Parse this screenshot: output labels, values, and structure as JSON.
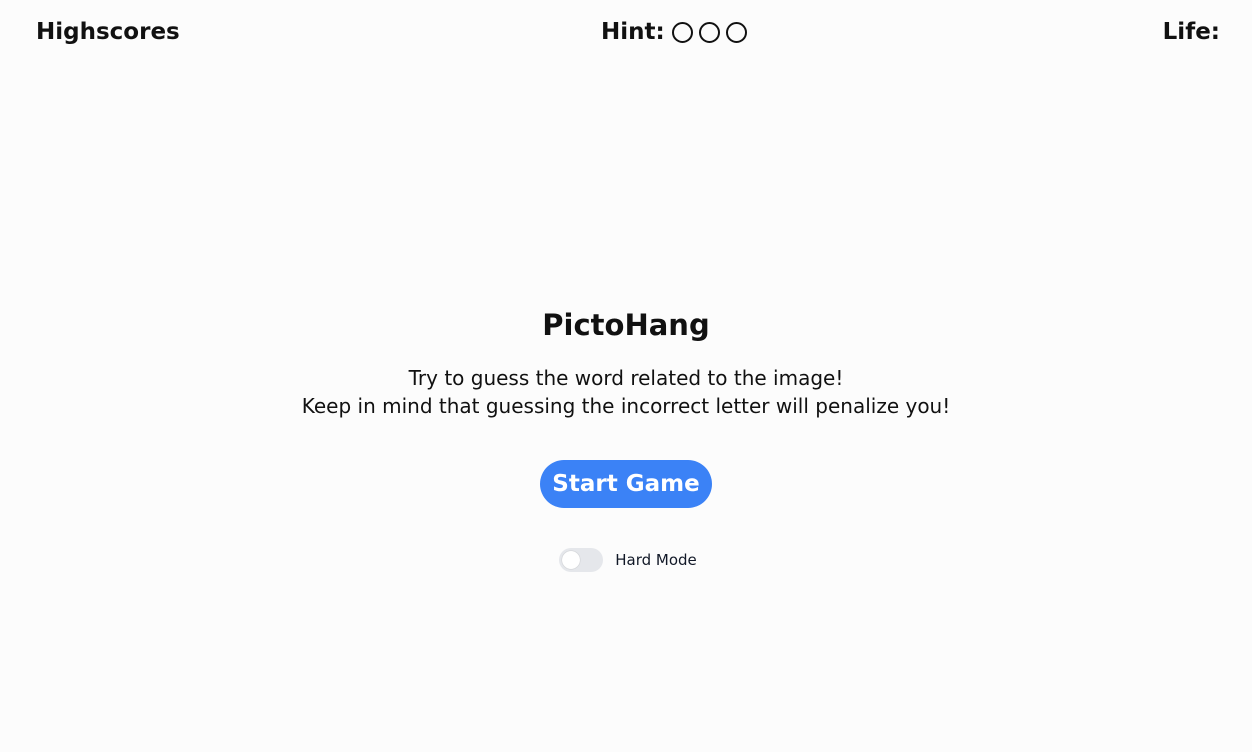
{
  "header": {
    "highscores_label": "Highscores",
    "hint_label": "Hint:",
    "hints": [
      "hint-1",
      "hint-2",
      "hint-3"
    ],
    "life_label": "Life:"
  },
  "main": {
    "title": "PictoHang",
    "description_line1": "Try to guess the word related to the image!",
    "description_line2": "Keep in mind that guessing the incorrect letter will penalize you!",
    "start_button_label": "Start Game",
    "hard_mode_label": "Hard Mode",
    "hard_mode_enabled": false
  },
  "colors": {
    "accent": "#3b82f6",
    "background": "#fcfcfc",
    "toggle_off": "#e5e7eb"
  }
}
